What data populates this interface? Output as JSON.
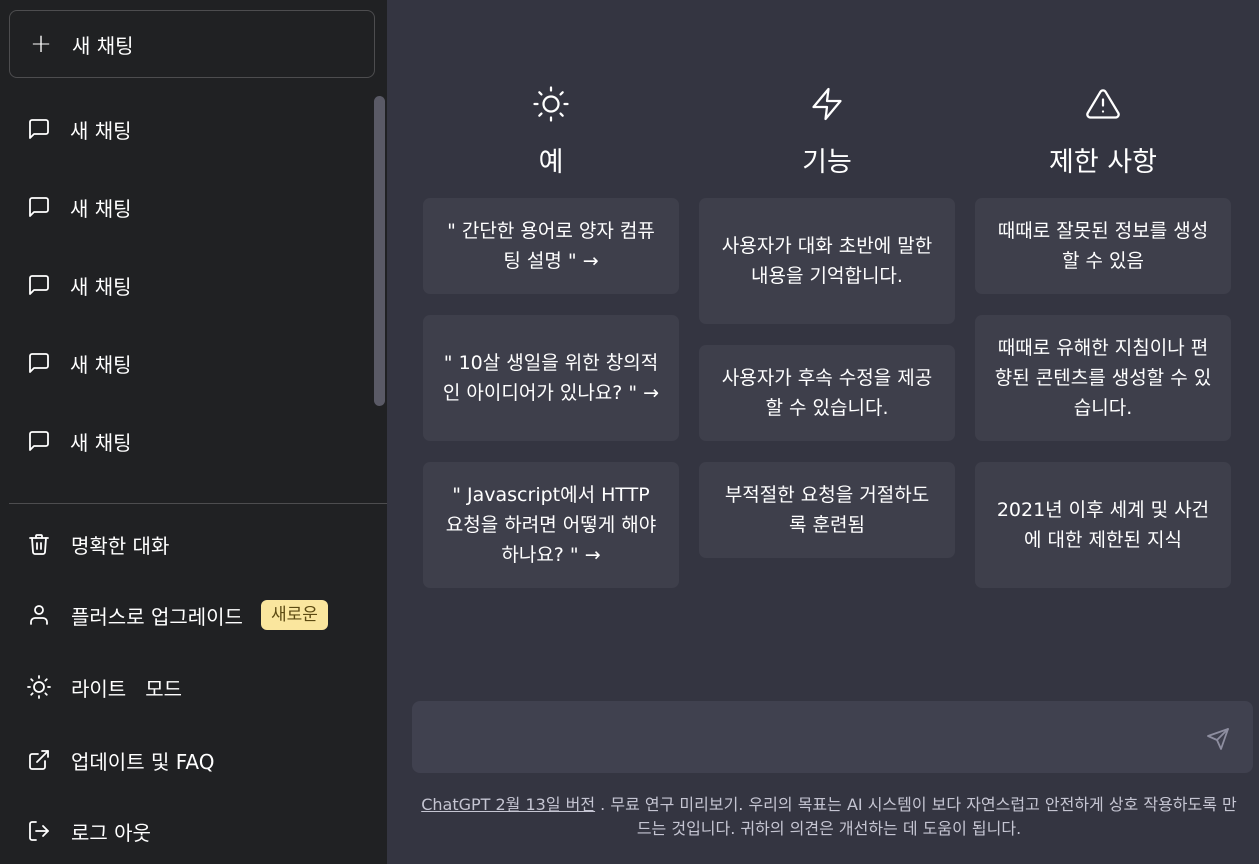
{
  "sidebar": {
    "new_chat_label": "새 채팅",
    "history": [
      {
        "label": "새 채팅"
      },
      {
        "label": "새 채팅"
      },
      {
        "label": "새 채팅"
      },
      {
        "label": "새 채팅"
      },
      {
        "label": "새 채팅"
      }
    ],
    "menu": {
      "clear": "명확한 대화",
      "upgrade": "플러스로 업그레이드",
      "upgrade_badge": "새로운",
      "light_mode": "라이트   모드",
      "updates": "업데이트 및 FAQ",
      "logout": "로그 아웃"
    }
  },
  "main": {
    "columns": [
      {
        "title": "예",
        "icon": "sun-icon",
        "cards": [
          "\" 간단한 용어로 양자 컴퓨팅 설명 \" →",
          "\" 10살 생일을 위한 창의적인 아이디어가 있나요? \" →",
          "\" Javascript에서 HTTP 요청을 하려면 어떻게 해야 하나요? \" →"
        ]
      },
      {
        "title": "기능",
        "icon": "lightning-icon",
        "cards": [
          "사용자가 대화 초반에 말한 내용을 기억합니다.",
          "사용자가 후속 수정을 제공할 수 있습니다.",
          "부적절한 요청을 거절하도록 훈련됨"
        ]
      },
      {
        "title": "제한 사항",
        "icon": "warning-icon",
        "cards": [
          "때때로 잘못된 정보를 생성할 수 있음",
          "때때로 유해한 지침이나 편향된 콘텐츠를 생성할 수 있습니다.",
          "2021년 이후 세계 및 사건에 대한 제한된 지식"
        ]
      }
    ],
    "input": {
      "value": "",
      "placeholder": ""
    },
    "footer": {
      "link": "ChatGPT 2월 13일 버전",
      "text": " . 무료 연구 미리보기. 우리의 목표는 AI 시스템이 보다 자연스럽고 안전하게 상호 작용하도록 만드는 것입니다. 귀하의 의견은 개선하는 데 도움이 됩니다."
    }
  },
  "colors": {
    "sidebar_bg": "#202123",
    "main_bg": "#343541",
    "card_bg": "#3e3f4b",
    "input_bg": "#40414f",
    "badge_bg": "#fae69e"
  }
}
